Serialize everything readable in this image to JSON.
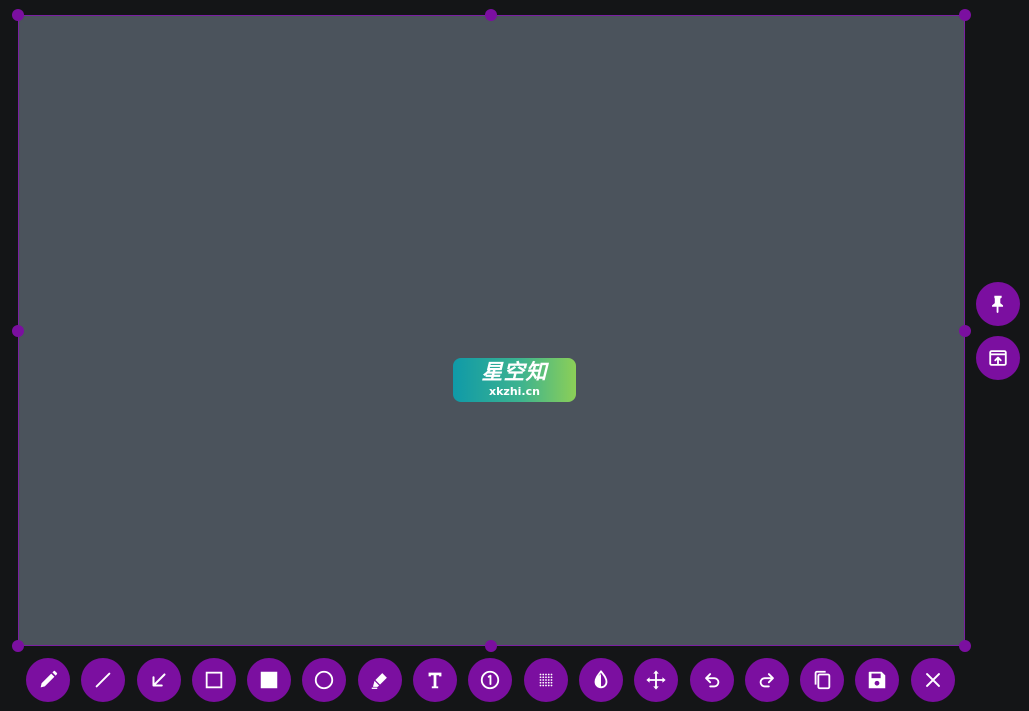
{
  "watermark": {
    "title": "星空知",
    "subtitle": "xkzhi.cn",
    "gradient": [
      "#0f9aa8",
      "#3db38f",
      "#8ccf57"
    ]
  },
  "colors": {
    "accent": "#7b0fa0",
    "selection_fill": "#4b535c",
    "background": "#141517",
    "icon": "#ffffff"
  },
  "side_tools": [
    {
      "name": "pin",
      "icon": "pin-icon"
    },
    {
      "name": "upload",
      "icon": "upload-window-icon"
    }
  ],
  "toolbar": [
    {
      "name": "pencil",
      "icon": "pencil-icon"
    },
    {
      "name": "line",
      "icon": "line-icon"
    },
    {
      "name": "arrow",
      "icon": "arrow-icon"
    },
    {
      "name": "rectangle",
      "icon": "rectangle-icon"
    },
    {
      "name": "filled-rectangle",
      "icon": "filled-rectangle-icon"
    },
    {
      "name": "circle",
      "icon": "circle-icon"
    },
    {
      "name": "marker",
      "icon": "marker-icon"
    },
    {
      "name": "text",
      "icon": "text-icon"
    },
    {
      "name": "counter",
      "icon": "counter-icon"
    },
    {
      "name": "pixelate",
      "icon": "pixelate-icon"
    },
    {
      "name": "invert",
      "icon": "invert-icon"
    },
    {
      "name": "move",
      "icon": "move-icon"
    },
    {
      "name": "undo",
      "icon": "undo-icon"
    },
    {
      "name": "redo",
      "icon": "redo-icon"
    },
    {
      "name": "copy",
      "icon": "copy-icon"
    },
    {
      "name": "save",
      "icon": "save-icon"
    },
    {
      "name": "close",
      "icon": "close-icon"
    }
  ]
}
